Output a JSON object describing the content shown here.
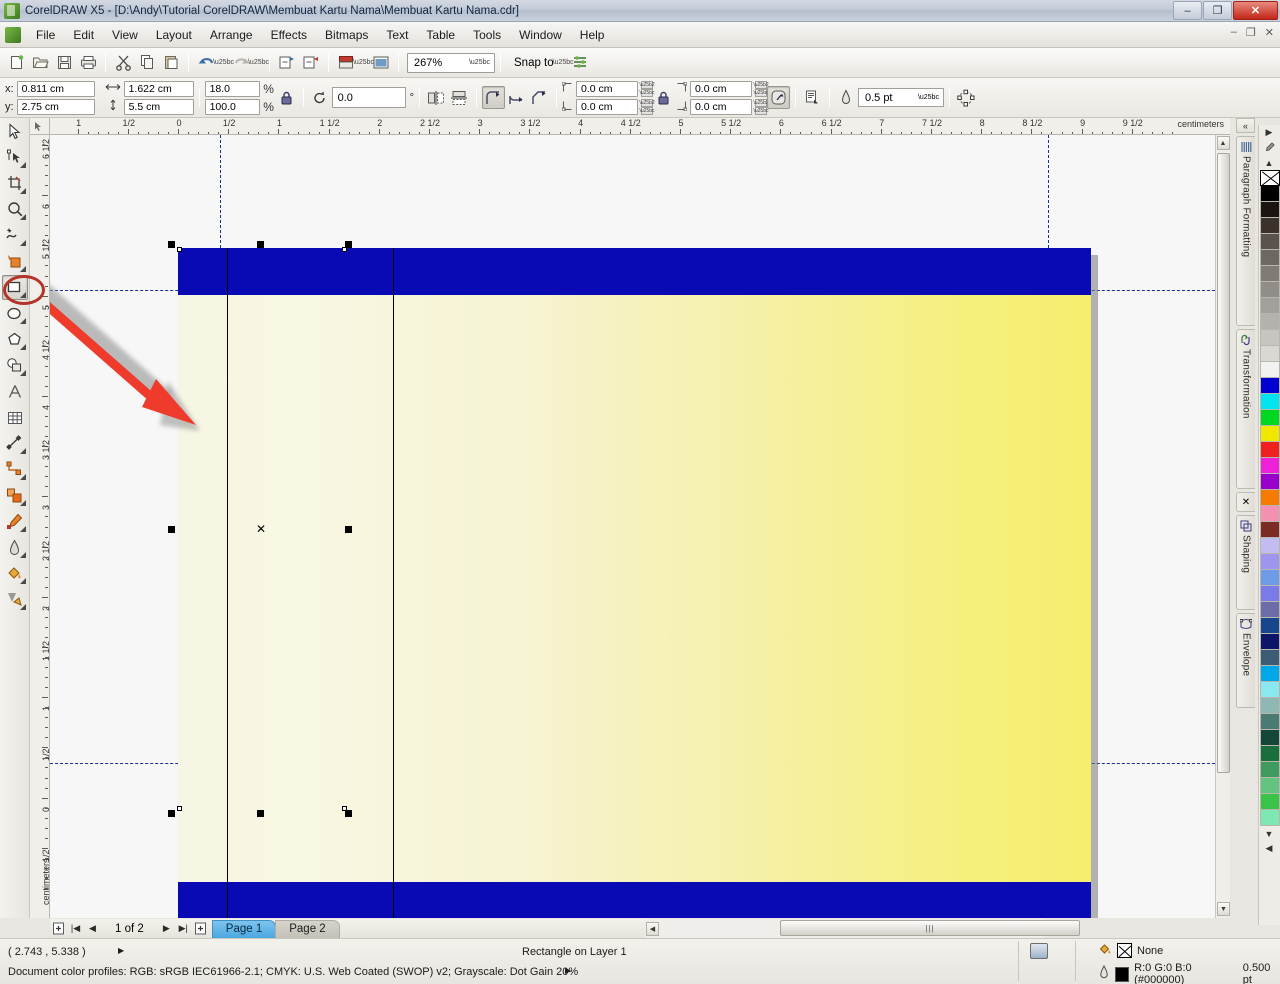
{
  "window": {
    "title": "CorelDRAW X5 - [D:\\Andy\\Tutorial CorelDRAW\\Membuat Kartu Nama\\Membuat Kartu Nama.cdr]",
    "minimize": "–",
    "maximize": "❐",
    "close": "✕",
    "mdi_minimize": "–",
    "mdi_restore": "❐",
    "mdi_close": "✕"
  },
  "menu": {
    "items": [
      {
        "label": "File"
      },
      {
        "label": "Edit"
      },
      {
        "label": "View"
      },
      {
        "label": "Layout"
      },
      {
        "label": "Arrange"
      },
      {
        "label": "Effects"
      },
      {
        "label": "Bitmaps"
      },
      {
        "label": "Text"
      },
      {
        "label": "Table"
      },
      {
        "label": "Tools"
      },
      {
        "label": "Window"
      },
      {
        "label": "Help"
      }
    ]
  },
  "toolbar": {
    "new_label": "New",
    "open_label": "Open",
    "save_label": "Save",
    "print_label": "Print",
    "cut_label": "Cut",
    "copy_label": "Copy",
    "paste_label": "Paste",
    "undo_label": "Undo",
    "redo_label": "Redo",
    "import_label": "Import",
    "export_label": "Export",
    "publish_pdf_label": "Publish to PDF",
    "app_launcher_label": "Application Launcher",
    "zoom_level": "267%",
    "snap_to_label": "Snap to",
    "options_label": "Options"
  },
  "property_bar": {
    "x_label": "x:",
    "x_value": "0.811 cm",
    "y_label": "y:",
    "y_value": "2.75 cm",
    "width_value": "1.622 cm",
    "height_value": "5.5 cm",
    "scale_h": "18.0",
    "scale_v": "100.0",
    "percent_symbol": "%",
    "lock_ratio_label": "Lock ratio",
    "rotation_value": "0.0",
    "degree_symbol": "°",
    "mirror_h_label": "Mirror horizontally",
    "mirror_v_label": "Mirror vertically",
    "corner_round_label": "Round corner",
    "corner_scallop_label": "Scalloped corner",
    "corner_chamfer_label": "Chamfered corner",
    "corner_tl_value": "0.0 cm",
    "corner_bl_value": "0.0 cm",
    "corner_tr_value": "0.0 cm",
    "corner_br_value": "0.0 cm",
    "edit_corners_label": "Edit corners together",
    "relative_corner_label": "Relative corner scaling",
    "wrap_text_label": "Wrap paragraph text",
    "outline_width": "0.5 pt",
    "convert_curves_label": "Convert to curves"
  },
  "toolbox": {
    "tools": [
      {
        "name": "pick-tool",
        "label": "Pick"
      },
      {
        "name": "shape-tool",
        "label": "Shape"
      },
      {
        "name": "crop-tool",
        "label": "Crop"
      },
      {
        "name": "zoom-tool",
        "label": "Zoom"
      },
      {
        "name": "freehand-tool",
        "label": "Freehand"
      },
      {
        "name": "smart-fill-tool",
        "label": "Smart Fill"
      },
      {
        "name": "rectangle-tool",
        "label": "Rectangle"
      },
      {
        "name": "ellipse-tool",
        "label": "Ellipse"
      },
      {
        "name": "polygon-tool",
        "label": "Polygon"
      },
      {
        "name": "basic-shapes-tool",
        "label": "Basic Shapes"
      },
      {
        "name": "text-tool",
        "label": "Text"
      },
      {
        "name": "table-tool",
        "label": "Table"
      },
      {
        "name": "dimension-tool",
        "label": "Dimension"
      },
      {
        "name": "connector-tool",
        "label": "Connector"
      },
      {
        "name": "blend-tool",
        "label": "Blend"
      },
      {
        "name": "color-eyedropper-tool",
        "label": "Color Eyedropper"
      },
      {
        "name": "outline-tool",
        "label": "Outline"
      },
      {
        "name": "fill-tool",
        "label": "Fill"
      },
      {
        "name": "interactive-fill-tool",
        "label": "Interactive Fill"
      }
    ],
    "active": "rectangle-tool"
  },
  "rulers": {
    "unit_label": "centimeters",
    "horizontal_ticks": [
      "1",
      "1/2",
      "0",
      "1/2",
      "1",
      "1 1/2",
      "2",
      "2 1/2",
      "3",
      "3 1/2",
      "4",
      "4 1/2",
      "5",
      "5 1/2",
      "6",
      "6 1/2",
      "7",
      "7 1/2",
      "8",
      "8 1/2",
      "9",
      "9 1/2"
    ],
    "vertical_ticks": [
      "6 1/2",
      "6",
      "5 1/2",
      "5",
      "4 1/2",
      "4",
      "3 1/2",
      "3",
      "2 1/2",
      "2",
      "1 1/2",
      "1",
      "1/2",
      "0",
      "1/2"
    ]
  },
  "dockers": {
    "collapse_label": "«",
    "tabs": [
      {
        "label": "Paragraph Formatting",
        "icon": "paragraph-icon"
      },
      {
        "label": "Transformation",
        "icon": "transform-icon"
      },
      {
        "label": "Shaping",
        "icon": "shaping-icon"
      },
      {
        "label": "Envelope",
        "icon": "envelope-icon"
      }
    ],
    "close_label": "✕"
  },
  "palette": {
    "none_label": "None",
    "colors": [
      "#000000",
      "#1c1410",
      "#3b322c",
      "#5a524c",
      "#6e6862",
      "#807b75",
      "#918d88",
      "#a3a09b",
      "#b5b2ae",
      "#c7c5c1",
      "#d9d8d5",
      "#f2f2f0",
      "#0000d0",
      "#00e5f0",
      "#00d820",
      "#f0e800",
      "#ef2020",
      "#ee20d8",
      "#9900cc",
      "#f57b00",
      "#f490b0",
      "#7b2a24",
      "#c2bdf0",
      "#9d95ee",
      "#6d9be8",
      "#7a7ae8",
      "#6c6ca8",
      "#16468c",
      "#0b1668",
      "#3b5c74",
      "#00a8e8",
      "#8ae8f0",
      "#8fb8b4",
      "#4a7a72",
      "#14463a",
      "#1a6e3c",
      "#3f9a60",
      "#62c47e",
      "#39c449",
      "#7de8b2"
    ],
    "scroll_down": "▼",
    "scroll_home": "◀"
  },
  "artwork": {
    "band_color": "#0a0ab4",
    "gradient_start": "#f7f6e4",
    "gradient_end": "#f5ee6f",
    "selected_object": "Rectangle"
  },
  "annotation": {
    "highlight_target": "rectangle-tool",
    "arrow_color": "#ef3b2c",
    "ellipse_color": "#b4342a"
  },
  "page_nav": {
    "add_page_start_label": "+",
    "first_label": "|◀",
    "prev_label": "◀",
    "counter": "1 of 2",
    "next_label": "▶",
    "last_label": "▶|",
    "add_page_end_label": "+",
    "tabs": [
      {
        "label": "Page 1",
        "active": true
      },
      {
        "label": "Page 2",
        "active": false
      }
    ]
  },
  "status_bar": {
    "coordinates": "( 2.743 , 5.338 )",
    "expand_arrow": "▶",
    "object_info": "Rectangle on Layer 1",
    "color_profiles": "Document color profiles: RGB: sRGB IEC61966-2.1; CMYK: U.S. Web Coated (SWOP) v2; Grayscale: Dot Gain 20%",
    "profiles_arrow": "▶",
    "fill_label": "None",
    "outline_label": "R:0 G:0 B:0 (#000000)",
    "outline_width": "0.500 pt"
  },
  "scrollbars": {
    "v_up": "▲",
    "v_down": "▼",
    "h_left": "◀",
    "h_right": "▶",
    "grip": "|||"
  }
}
